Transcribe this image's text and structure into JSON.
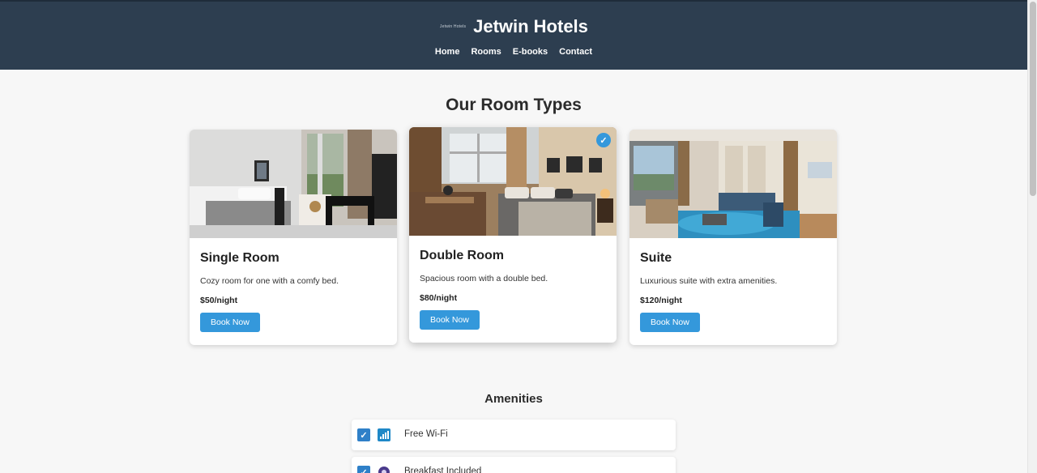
{
  "header": {
    "logo_text": "Jetwin Hotels",
    "brand_name": "Jetwin Hotels",
    "nav": [
      "Home",
      "Rooms",
      "E-books",
      "Contact"
    ]
  },
  "rooms": {
    "title": "Our Room Types",
    "cards": [
      {
        "title": "Single Room",
        "description": "Cozy room for one with a comfy bed.",
        "price": "$50/night",
        "button": "Book Now",
        "selected": false
      },
      {
        "title": "Double Room",
        "description": "Spacious room with a double bed.",
        "price": "$80/night",
        "button": "Book Now",
        "selected": true
      },
      {
        "title": "Suite",
        "description": "Luxurious suite with extra amenities.",
        "price": "$120/night",
        "button": "Book Now",
        "selected": false
      }
    ],
    "selected_badge": "✓"
  },
  "amenities": {
    "title": "Amenities",
    "items": [
      {
        "label": "Free Wi-Fi",
        "icon": "wifi-signal-icon",
        "checked": true,
        "check_mark": "✓"
      },
      {
        "label": "Breakfast Included",
        "icon": "breakfast-icon",
        "checked": true,
        "check_mark": "✓"
      }
    ]
  },
  "colors": {
    "header_bg": "#2d3e50",
    "accent": "#3498db",
    "page_bg": "#f7f7f7"
  }
}
